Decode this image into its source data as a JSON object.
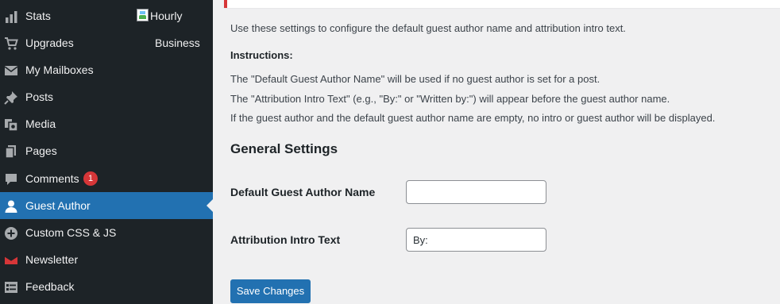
{
  "sidebar": {
    "items": [
      {
        "label": "Stats",
        "icon": "stats-icon"
      },
      {
        "label": "Upgrades",
        "icon": "cart-icon"
      },
      {
        "label": "My Mailboxes",
        "icon": "mail-icon"
      },
      {
        "label": "Posts",
        "icon": "pushpin-icon"
      },
      {
        "label": "Media",
        "icon": "media-icon"
      },
      {
        "label": "Pages",
        "icon": "pages-icon"
      },
      {
        "label": "Comments",
        "icon": "comment-icon",
        "badge": "1"
      },
      {
        "label": "Guest Author",
        "icon": "user-icon",
        "active": true
      },
      {
        "label": "Custom CSS & JS",
        "icon": "plus-circle-icon"
      },
      {
        "label": "Newsletter",
        "icon": "newsletter-icon"
      },
      {
        "label": "Feedback",
        "icon": "feedback-icon"
      }
    ],
    "hourly_image_alt": "Hourly",
    "business_label": "Business"
  },
  "main": {
    "intro": "Use these settings to configure the default guest author name and attribution intro text.",
    "instructions_heading": "Instructions:",
    "instructions": [
      "The \"Default Guest Author Name\" will be used if no guest author is set for a post.",
      "The \"Attribution Intro Text\" (e.g., \"By:\" or \"Written by:\") will appear before the guest author name.",
      "If the guest author and the default guest author name are empty, no intro or guest author will be displayed."
    ],
    "section_title": "General Settings",
    "fields": {
      "default_author": {
        "label": "Default Guest Author Name",
        "value": ""
      },
      "intro_text": {
        "label": "Attribution Intro Text",
        "value": "By:"
      }
    },
    "save_label": "Save Changes"
  },
  "colors": {
    "sidebar_bg": "#1d2327",
    "active_bg": "#2271b1",
    "badge": "#d63638",
    "page_bg": "#f0f0f1"
  }
}
